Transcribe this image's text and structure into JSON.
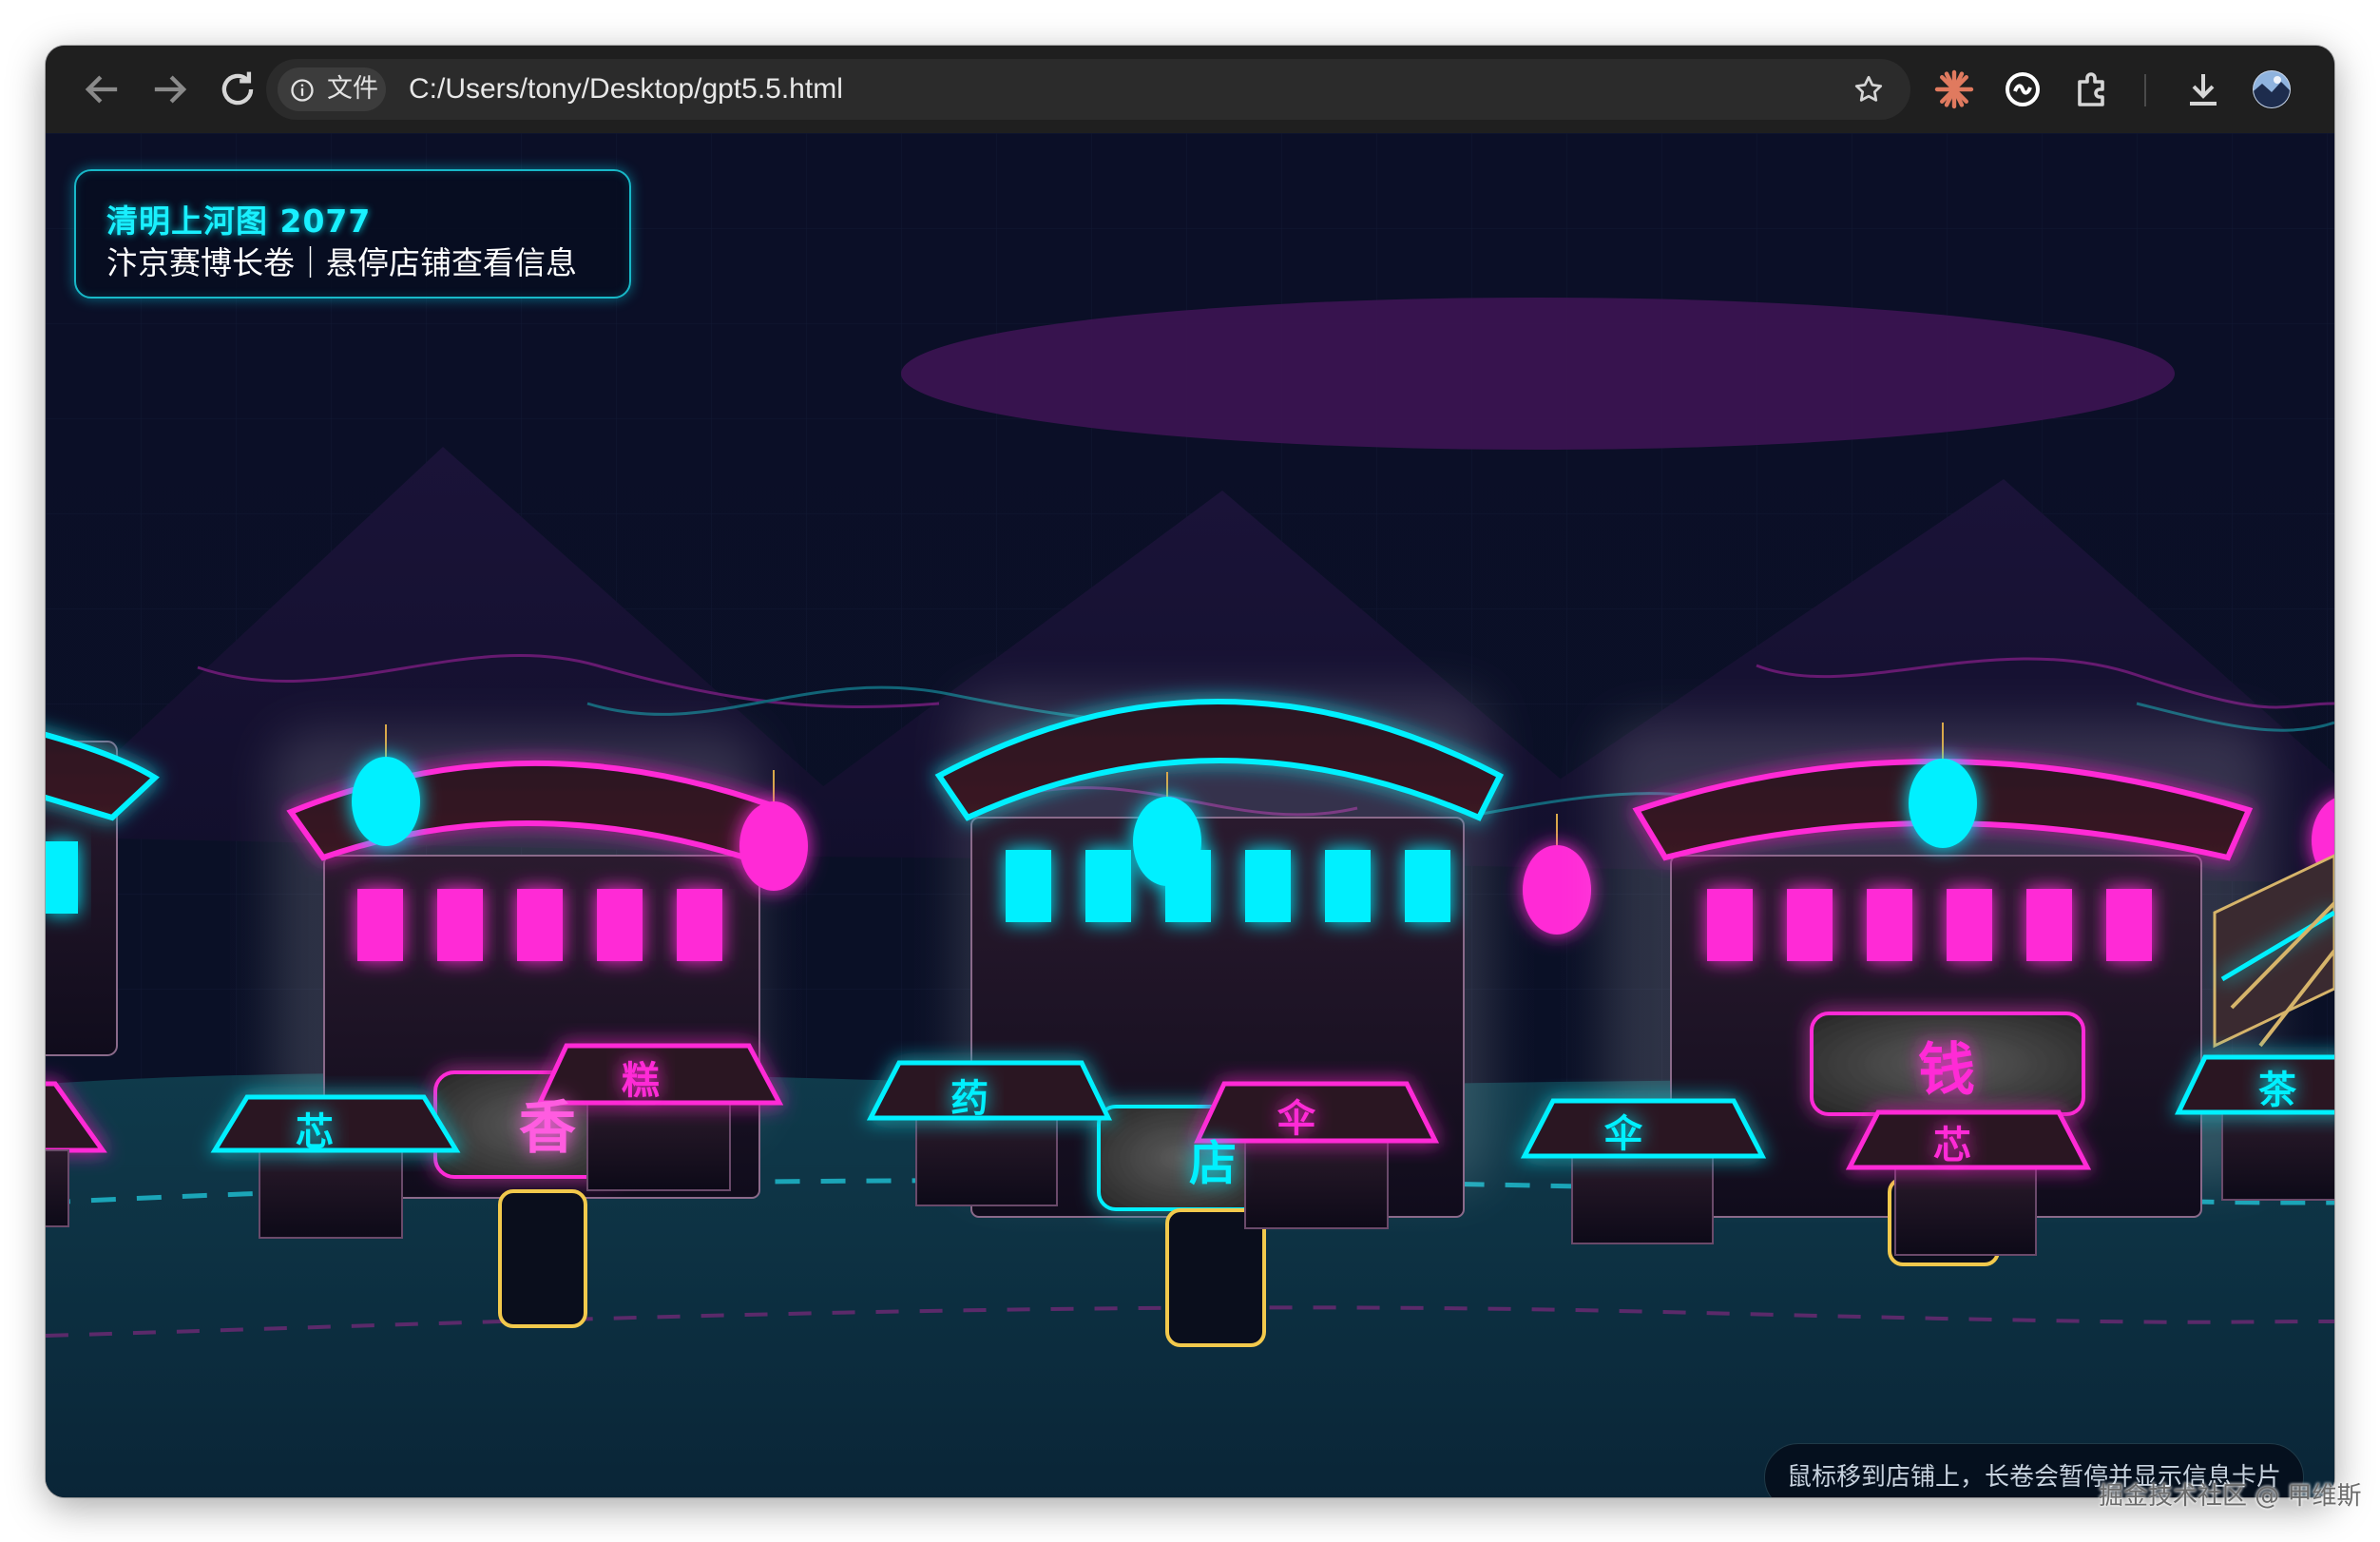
{
  "browser": {
    "chip_label": "文件",
    "url": "C:/Users/tony/Desktop/gpt5.5.html",
    "icons": [
      "back-icon",
      "forward-icon",
      "reload-icon",
      "info-icon",
      "star-icon",
      "claude-icon",
      "extension-shape-icon",
      "puzzle-icon",
      "download-icon",
      "profile-avatar",
      "more-vert-icon"
    ]
  },
  "page": {
    "title": "清明上河图 2077",
    "subtitle": "汴京赛博长卷｜悬停店铺查看信息",
    "hint": "鼠标移到店铺上，长卷会暂停并显示信息卡片"
  },
  "stalls": [
    {
      "label": "芯",
      "accent": "cyan"
    },
    {
      "label": "香",
      "accent": "magenta"
    },
    {
      "label": "糕",
      "accent": "magenta"
    },
    {
      "label": "药",
      "accent": "cyan"
    },
    {
      "label": "店",
      "accent": "cyan"
    },
    {
      "label": "伞",
      "accent": "magenta"
    },
    {
      "label": "伞",
      "accent": "cyan"
    },
    {
      "label": "钱",
      "accent": "magenta"
    },
    {
      "label": "芯",
      "accent": "magenta"
    },
    {
      "label": "茶",
      "accent": "cyan"
    }
  ],
  "colors": {
    "cyan": "#00f0ff",
    "magenta": "#ff2bd6",
    "gold": "#f2c94c",
    "sky": "#0a0e22",
    "river": "#0e3442"
  },
  "watermark": "掘金技术社区 @ 甲维斯"
}
